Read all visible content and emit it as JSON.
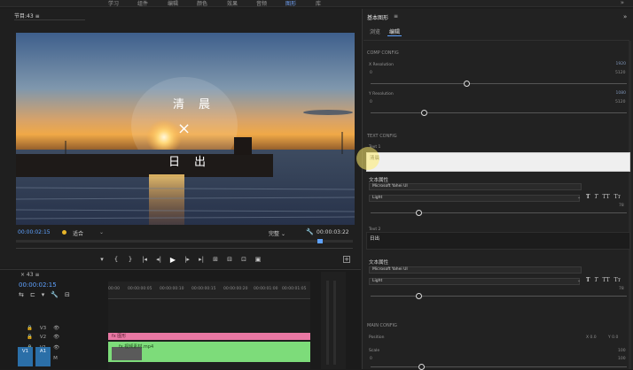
{
  "topbar": {
    "workspaces": [
      "学习",
      "组件",
      "编辑",
      "颜色",
      "效果",
      "音频",
      "图形",
      "库"
    ],
    "active_index": 6,
    "more": "»"
  },
  "monitor": {
    "title": "节目:43",
    "menu_icon": "≡",
    "overlay_line1": "清晨",
    "overlay_cross": "×",
    "overlay_line2": "日出",
    "timecode_left": "00:00:02:15",
    "fit_label": "适合",
    "fit_arrow": "⌄",
    "quality_label": "完整",
    "quality_arrow": "⌄",
    "timecode_right": "00:00:03:22",
    "transport": [
      "▾",
      "{",
      "}",
      "|◂",
      "◂|",
      "▶",
      "|▸",
      "▸|",
      "⊞",
      "⊟",
      "⊡",
      "▣"
    ],
    "add_button": "+"
  },
  "timeline": {
    "close_label": "×  43  ≡",
    "timecode": "00:00:02:15",
    "tools": [
      "⇆",
      "⊏",
      "▾",
      "🔧",
      "⊟"
    ],
    "ruler_ticks": [
      "00:00",
      "00:00:00:05",
      "00:00:00:10",
      "00:00:00:15",
      "00:00:00:20",
      "00:00:01:00",
      "00:00:01:05"
    ],
    "tracks": [
      {
        "lock": "🔒",
        "name": "V3",
        "eye": "👁"
      },
      {
        "lock": "🔒",
        "name": "V2",
        "eye": "👁"
      },
      {
        "lock": "🔒",
        "name": "V1",
        "eye": "👁"
      },
      {
        "lock": "🔒",
        "name": "A1",
        "eye": "M"
      }
    ],
    "v_tags": [
      "V1",
      "A1"
    ],
    "pink_clip": "fx 图形",
    "green_clip": "fx 视频素材.mp4"
  },
  "essential_graphics": {
    "title": "基本图形",
    "menu": "≡",
    "more": "»",
    "tabs": [
      "浏览",
      "编辑"
    ],
    "comp_config": "COMP CONFIG",
    "x_resolution": {
      "label": "X Resolution",
      "min": "0",
      "max": "5120",
      "current": "1920",
      "value": 0.375
    },
    "y_resolution": {
      "label": "Y Resolution",
      "min": "0",
      "max": "5120",
      "current": "1080",
      "value": 0.21
    },
    "text_config": "TEXT CONFIG",
    "text1": {
      "label": "Text 1",
      "value": "清晨"
    },
    "text1_props": {
      "label": "文本属性",
      "font": "Microsoft Yahei UI",
      "weight": "Light",
      "size": "78",
      "value": 0.19,
      "style_icons": [
        "T",
        "T",
        "TT",
        "Tт"
      ]
    },
    "text2": {
      "label": "Text 2",
      "value": "日出"
    },
    "text2_props": {
      "label": "文本属性",
      "font": "Microsoft Yahei UI",
      "weight": "Light",
      "size": "78",
      "value": 0.19
    },
    "main_config": "MAIN CONFIG",
    "position": {
      "label": "Position",
      "x": "X 0.0",
      "y": "Y 0.0"
    },
    "scale": {
      "label": "Scale",
      "max": "100",
      "min": "0",
      "top": "100",
      "value": 0.2
    }
  },
  "colors": {
    "accent": "#5fa2ff",
    "clip_pink": "#e978a4",
    "clip_green": "#7ddc7a",
    "v_tag": "#2b6fa8"
  }
}
